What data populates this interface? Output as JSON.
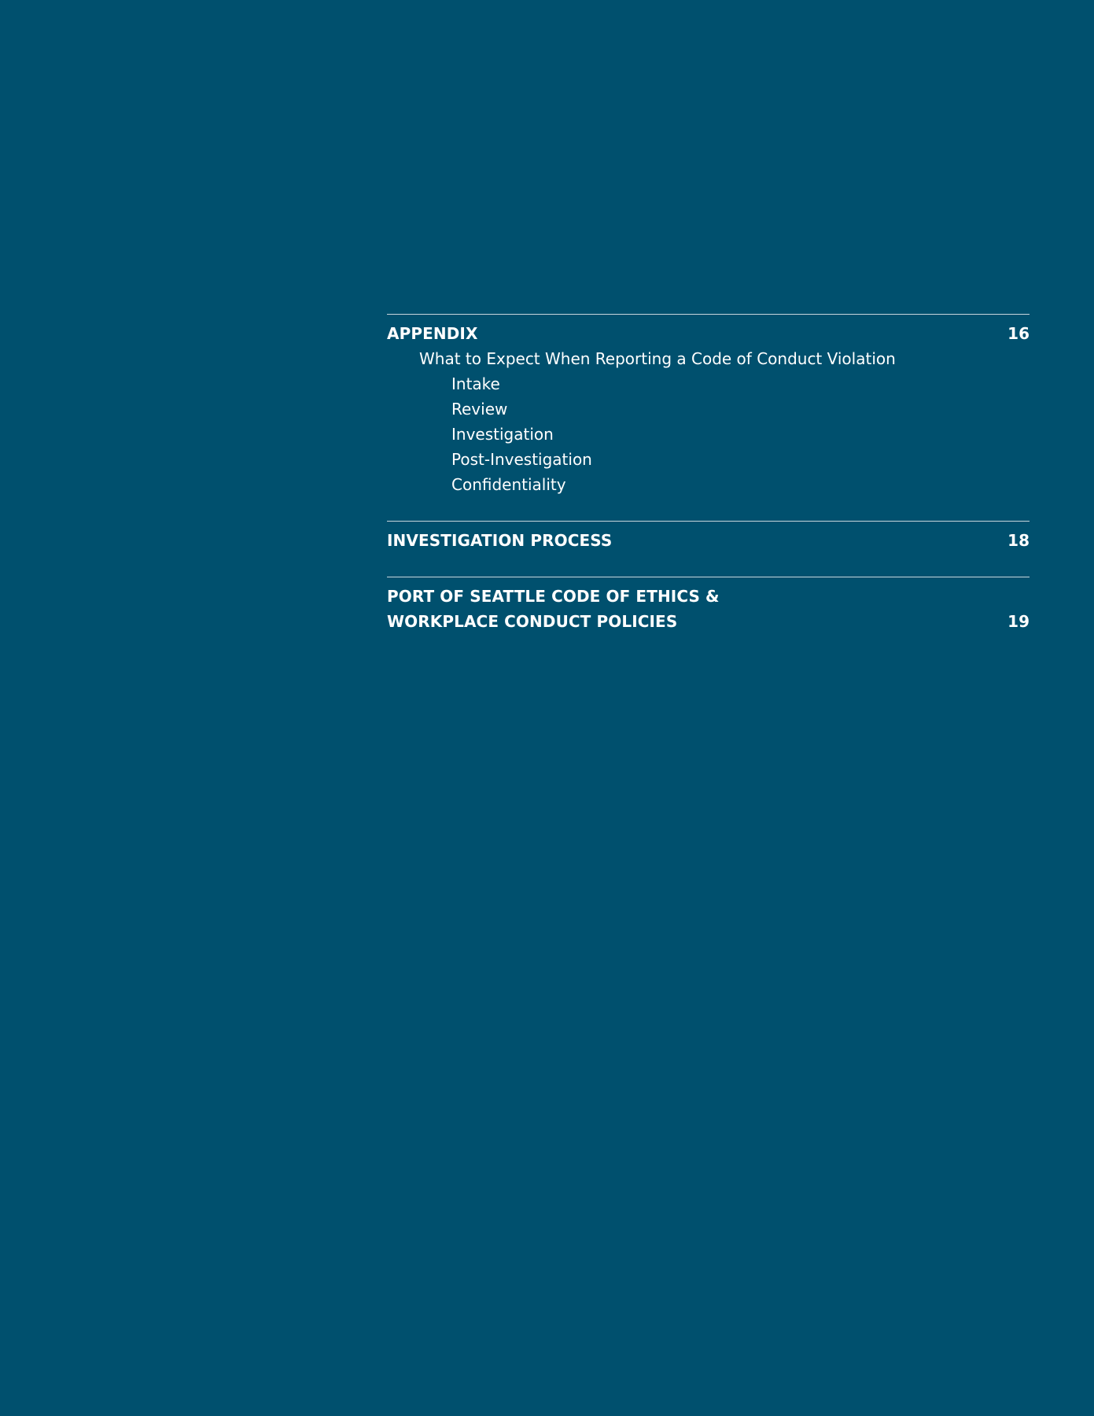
{
  "toc": {
    "appendix": {
      "title": "APPENDIX",
      "page": "16",
      "subheading": "What to Expect When Reporting a Code of Conduct Violation",
      "items": [
        "Intake",
        "Review",
        "Investigation",
        "Post-Investigation",
        "Confidentiality"
      ]
    },
    "investigation": {
      "title": "INVESTIGATION PROCESS",
      "page": "18"
    },
    "policies": {
      "title_line1": "PORT OF SEATTLE CODE OF ETHICS &",
      "title_line2": "WORKPLACE CONDUCT POLICIES",
      "page": "19"
    }
  }
}
